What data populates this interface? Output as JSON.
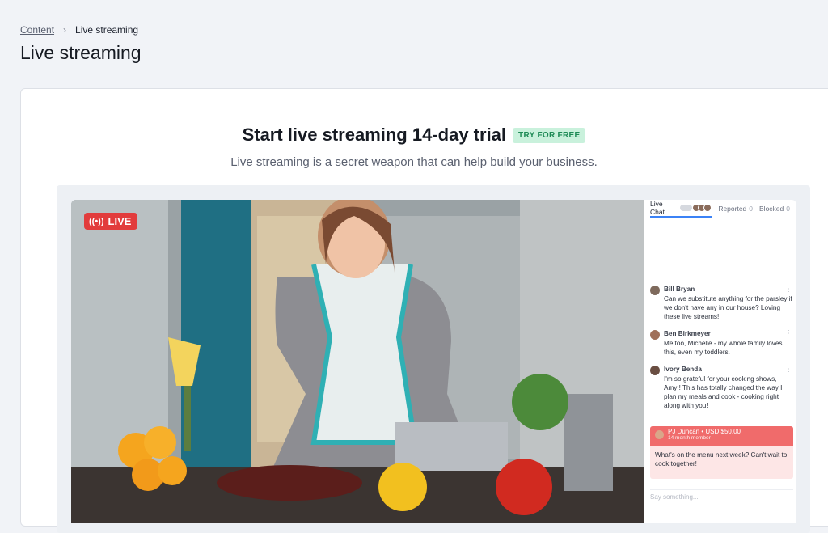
{
  "breadcrumb": {
    "parent": "Content",
    "current": "Live streaming"
  },
  "page_title": "Live streaming",
  "promo": {
    "title": "Start live streaming 14-day trial",
    "badge": "TRY FOR FREE",
    "subtitle": "Live streaming is a secret weapon that can help build your business."
  },
  "video": {
    "live_label": "LIVE"
  },
  "chat": {
    "tabs": [
      {
        "label": "Live Chat",
        "count": ""
      },
      {
        "label": "Reported",
        "count": "0"
      },
      {
        "label": "Blocked",
        "count": "0"
      }
    ],
    "messages": [
      {
        "name": "Bill Bryan",
        "text": "Can we substitute anything for the parsley if we don't have any in our house? Loving these live streams!"
      },
      {
        "name": "Ben Birkmeyer",
        "text": "Me too, Michelle - my whole family loves this, even my toddlers."
      },
      {
        "name": "Ivory Benda",
        "text": "I'm so grateful for your cooking shows, Amy!! This has totally changed the way I plan my meals and cook - cooking right along with you!"
      }
    ],
    "donation": {
      "name": "PJ Duncan",
      "amount": "USD $50.00",
      "sub": "14 month member",
      "text": "What's on the menu next week? Can't wait to cook together!"
    },
    "input_placeholder": "Say something..."
  },
  "colors": {
    "accent": "#3b82f6",
    "live": "#e23c3c",
    "badge_bg": "#c9f1dc",
    "badge_text": "#1d8a55",
    "donation": "#f06b6b"
  }
}
